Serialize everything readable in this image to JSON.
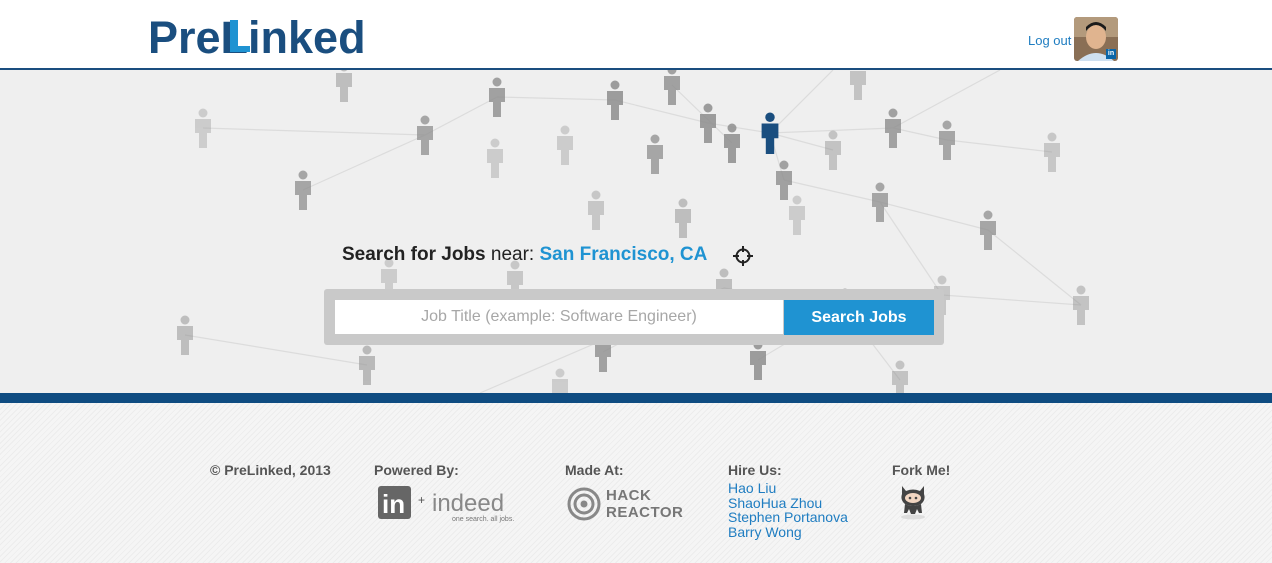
{
  "header": {
    "logo_text": "PreLinked",
    "logout_label": "Log out",
    "avatar_badge": "in"
  },
  "search": {
    "heading_bold": "Search for Jobs",
    "heading_near": " near: ",
    "location": "San Francisco, CA",
    "placeholder": "Job Title (example: Software Engineer)",
    "button_label": "Search Jobs"
  },
  "footer": {
    "copyright": "© PreLinked, 2013",
    "powered_by_title": "Powered By:",
    "linkedin_logo": "in",
    "plus": "+",
    "indeed_logo": "indeed",
    "indeed_tagline": "one search. all jobs.",
    "made_at_title": "Made At:",
    "hack_reactor_line1": "HACK",
    "hack_reactor_line2": "REACTOR",
    "hire_us_title": "Hire Us:",
    "hire_us_names": [
      "Hao Liu",
      "ShaoHua Zhou",
      "Stephen Portanova",
      "Barry Wong"
    ],
    "fork_me_title": "Fork Me!"
  },
  "colors": {
    "brand_dark": "#1a4e7f",
    "brand_light": "#1f93d2",
    "footer_bar": "#0f4c81"
  },
  "icons": [
    "target-location-icon",
    "user-avatar",
    "linkedin-icon",
    "github-octocat-icon"
  ]
}
